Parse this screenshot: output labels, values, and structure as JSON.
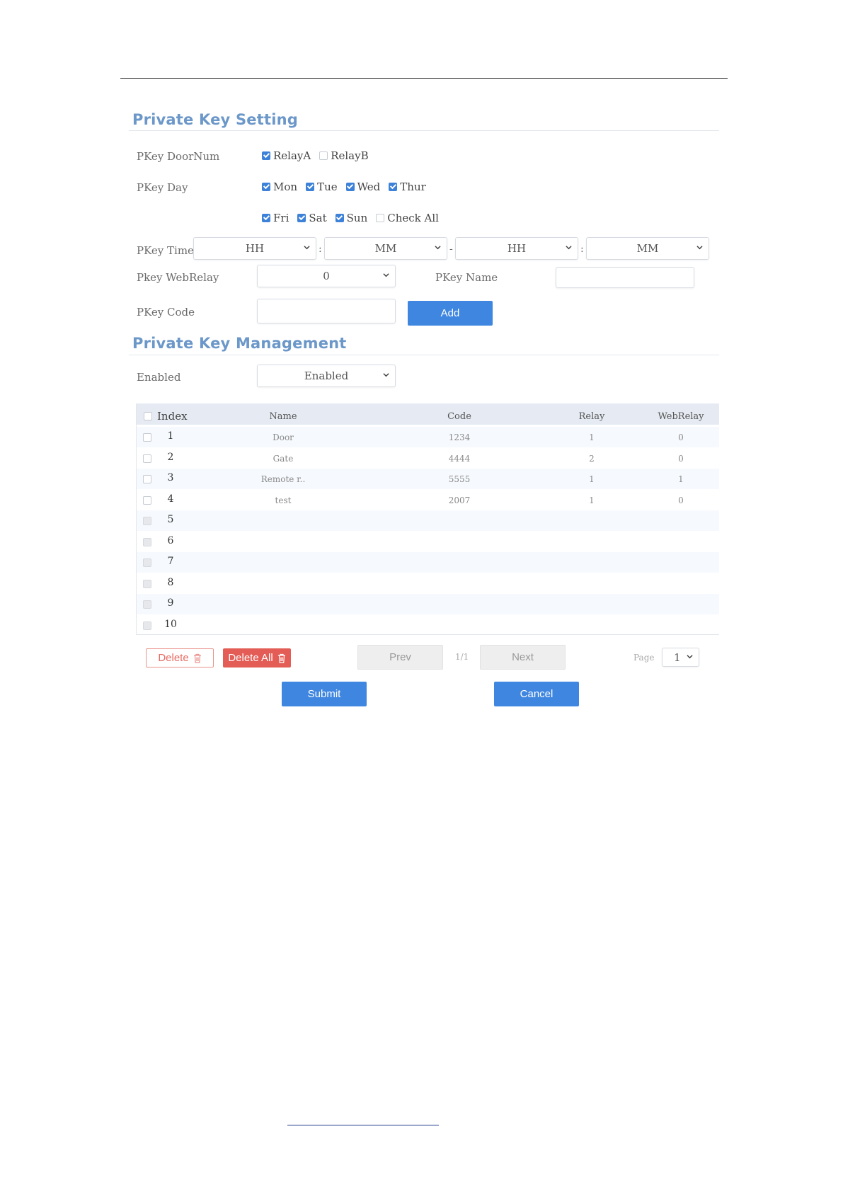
{
  "setting": {
    "title": "Private Key Setting",
    "door_num_label": "PKey DoorNum",
    "relay_a": "RelayA",
    "relay_b": "RelayB",
    "day_label": "PKey Day",
    "days": {
      "mon": "Mon",
      "tue": "Tue",
      "wed": "Wed",
      "thur": "Thur",
      "fri": "Fri",
      "sat": "Sat",
      "sun": "Sun",
      "check_all": "Check All"
    },
    "time_label": "PKey Time",
    "time_start_hh": "HH",
    "time_start_mm": "MM",
    "time_end_hh": "HH",
    "time_end_mm": "MM",
    "colon": ":",
    "dash": "-",
    "webrelay_label": "Pkey WebRelay",
    "webrelay_value": "0",
    "name_label": "PKey Name",
    "code_label": "PKey Code",
    "add_button": "Add"
  },
  "management": {
    "title": "Private Key Management",
    "enabled_label": "Enabled",
    "enabled_value": "Enabled",
    "columns": {
      "index": "Index",
      "name": "Name",
      "code": "Code",
      "relay": "Relay",
      "webrelay": "WebRelay"
    },
    "rows": [
      {
        "index": "1",
        "name": "Door",
        "code": "1234",
        "relay": "1",
        "webrelay": "0"
      },
      {
        "index": "2",
        "name": "Gate",
        "code": "4444",
        "relay": "2",
        "webrelay": "0"
      },
      {
        "index": "3",
        "name": "Remote r..",
        "code": "5555",
        "relay": "1",
        "webrelay": "1"
      },
      {
        "index": "4",
        "name": "test",
        "code": "2007",
        "relay": "1",
        "webrelay": "0"
      },
      {
        "index": "5",
        "name": "",
        "code": "",
        "relay": "",
        "webrelay": ""
      },
      {
        "index": "6",
        "name": "",
        "code": "",
        "relay": "",
        "webrelay": ""
      },
      {
        "index": "7",
        "name": "",
        "code": "",
        "relay": "",
        "webrelay": ""
      },
      {
        "index": "8",
        "name": "",
        "code": "",
        "relay": "",
        "webrelay": ""
      },
      {
        "index": "9",
        "name": "",
        "code": "",
        "relay": "",
        "webrelay": ""
      },
      {
        "index": "10",
        "name": "",
        "code": "",
        "relay": "",
        "webrelay": ""
      }
    ],
    "delete_button": "Delete",
    "delete_all_button": "Delete All",
    "prev_button": "Prev",
    "page_count": "1/1",
    "next_button": "Next",
    "page_label": "Page",
    "page_value": "1",
    "submit_button": "Submit",
    "cancel_button": "Cancel"
  },
  "colors": {
    "accent": "#3f86e0",
    "title": "#6b97c9",
    "danger": "#e35c55"
  }
}
